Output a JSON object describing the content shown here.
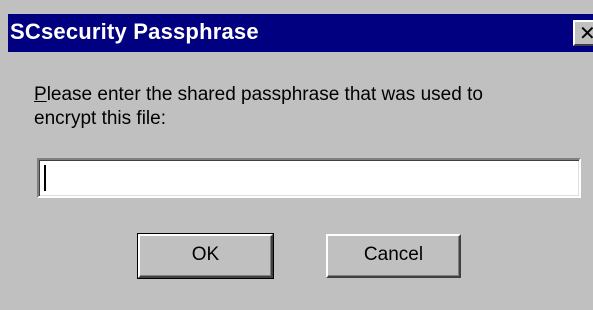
{
  "window": {
    "title": "SCsecurity Passphrase",
    "close_icon": "close-icon",
    "close_glyph": "✕"
  },
  "dialog": {
    "prompt_mnemonic": "P",
    "prompt_rest_line1": "lease enter the shared passphrase that was used to",
    "prompt_line2": "encrypt this file:",
    "passphrase_value": "",
    "ok_label": "OK",
    "cancel_label": "Cancel"
  },
  "colors": {
    "titlebar": "#000080",
    "face": "#c0c0c0",
    "field": "#ffffff"
  }
}
